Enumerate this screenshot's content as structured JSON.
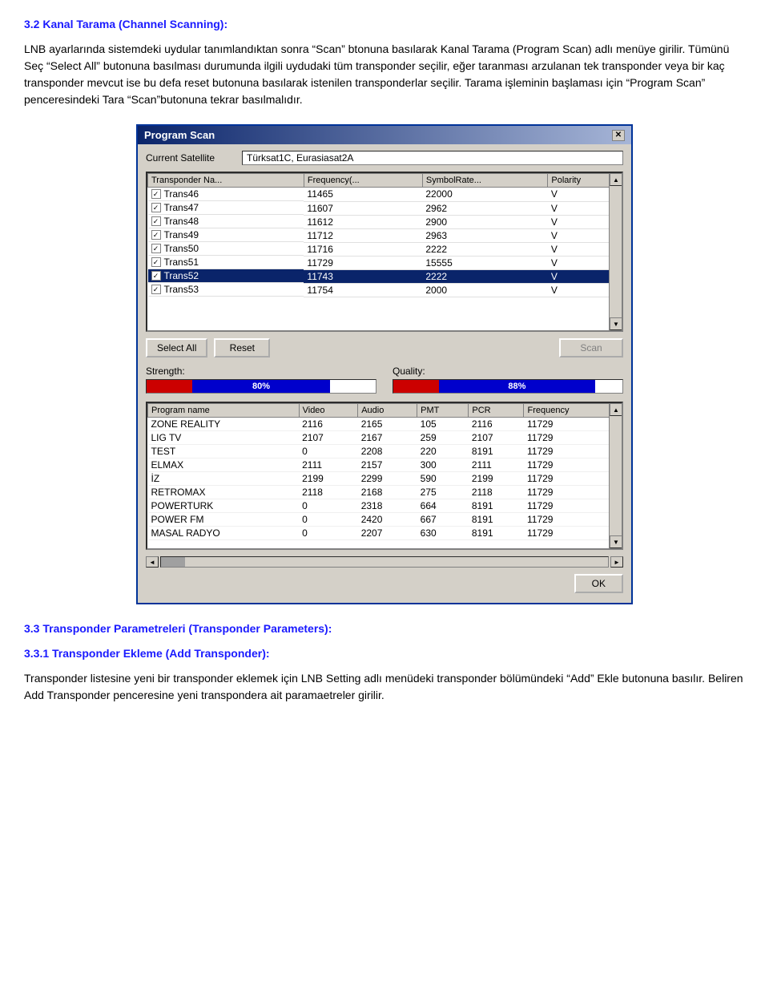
{
  "heading1": {
    "text": "3.2 Kanal Tarama (Channel Scanning):"
  },
  "para1": {
    "text": "LNB ayarlarında sistemdeki uydular tanımlandıktan sonra “Scan” btonuna basılarak Kanal Tarama (Program Scan) adlı menüye girilir. Tümünü Seç “Select All” butonuna basılması durumunda ilgili uydudaki tüm transponder seçilir, eğer taranması arzulanan tek transponder veya bir kaç transponder mevcut ise bu defa reset butonuna basılarak istenilen transponderlar seçilir. Tarama işleminin başlaması için “Program Scan” penceresindeki Tara “Scan”butonuna tekrar basılmalıdır."
  },
  "dialog": {
    "title": "Program Scan",
    "close_btn": "✕",
    "current_satellite_label": "Current Satellite",
    "current_satellite_value": "Türksat1C, Eurasiasat2A",
    "columns": [
      "Transponder Na...",
      "Frequency(...",
      "SymbolRate...",
      "Polarity"
    ],
    "transponders": [
      {
        "name": "Trans46",
        "freq": "11465",
        "symbol": "22000",
        "polarity": "V",
        "checked": true,
        "selected": false
      },
      {
        "name": "Trans47",
        "freq": "11607",
        "symbol": "2962",
        "polarity": "V",
        "checked": true,
        "selected": false
      },
      {
        "name": "Trans48",
        "freq": "11612",
        "symbol": "2900",
        "polarity": "V",
        "checked": true,
        "selected": false
      },
      {
        "name": "Trans49",
        "freq": "11712",
        "symbol": "2963",
        "polarity": "V",
        "checked": true,
        "selected": false
      },
      {
        "name": "Trans50",
        "freq": "11716",
        "symbol": "2222",
        "polarity": "V",
        "checked": true,
        "selected": false
      },
      {
        "name": "Trans51",
        "freq": "11729",
        "symbol": "15555",
        "polarity": "V",
        "checked": true,
        "selected": false
      },
      {
        "name": "Trans52",
        "freq": "11743",
        "symbol": "2222",
        "polarity": "V",
        "checked": true,
        "selected": true
      },
      {
        "name": "Trans53",
        "freq": "11754",
        "symbol": "2000",
        "polarity": "V",
        "checked": true,
        "selected": false
      }
    ],
    "select_all_label": "Select All",
    "reset_label": "Reset",
    "scan_label": "Scan",
    "strength_label": "Strength:",
    "strength_percent": "80%",
    "strength_red_pct": 20,
    "strength_blue_pct": 60,
    "quality_label": "Quality:",
    "quality_percent": "88%",
    "quality_red_pct": 20,
    "quality_blue_pct": 68,
    "program_columns": [
      "Program name",
      "Video",
      "Audio",
      "PMT",
      "PCR",
      "Frequency"
    ],
    "programs": [
      {
        "name": "ZONE REALITY",
        "video": "2116",
        "audio": "2165",
        "pmt": "105",
        "pcr": "2116",
        "freq": "11729"
      },
      {
        "name": "LIG TV",
        "video": "2107",
        "audio": "2167",
        "pmt": "259",
        "pcr": "2107",
        "freq": "11729"
      },
      {
        "name": "TEST",
        "video": "0",
        "audio": "2208",
        "pmt": "220",
        "pcr": "8191",
        "freq": "11729"
      },
      {
        "name": "ELMAX",
        "video": "2111",
        "audio": "2157",
        "pmt": "300",
        "pcr": "2111",
        "freq": "11729"
      },
      {
        "name": "İZ",
        "video": "2199",
        "audio": "2299",
        "pmt": "590",
        "pcr": "2199",
        "freq": "11729"
      },
      {
        "name": "RETROMAX",
        "video": "2118",
        "audio": "2168",
        "pmt": "275",
        "pcr": "2118",
        "freq": "11729"
      },
      {
        "name": "POWERTURK",
        "video": "0",
        "audio": "2318",
        "pmt": "664",
        "pcr": "8191",
        "freq": "11729"
      },
      {
        "name": "POWER FM",
        "video": "0",
        "audio": "2420",
        "pmt": "667",
        "pcr": "8191",
        "freq": "11729"
      },
      {
        "name": "MASAL RADYO",
        "video": "0",
        "audio": "2207",
        "pmt": "630",
        "pcr": "8191",
        "freq": "11729"
      }
    ],
    "ok_label": "OK"
  },
  "heading2": {
    "text": "3.3 Transponder Parametreleri (Transponder Parameters):"
  },
  "subheading": {
    "text": "3.3.1 Transponder Ekleme (Add Transponder):"
  },
  "para2": {
    "text": "Transponder listesine yeni bir transponder eklemek için LNB Setting adlı menüdeki transponder bölümündeki “Add” Ekle butonuna basılır. Beliren Add Transponder penceresine yeni transpondera ait paramaetreler girilir."
  }
}
